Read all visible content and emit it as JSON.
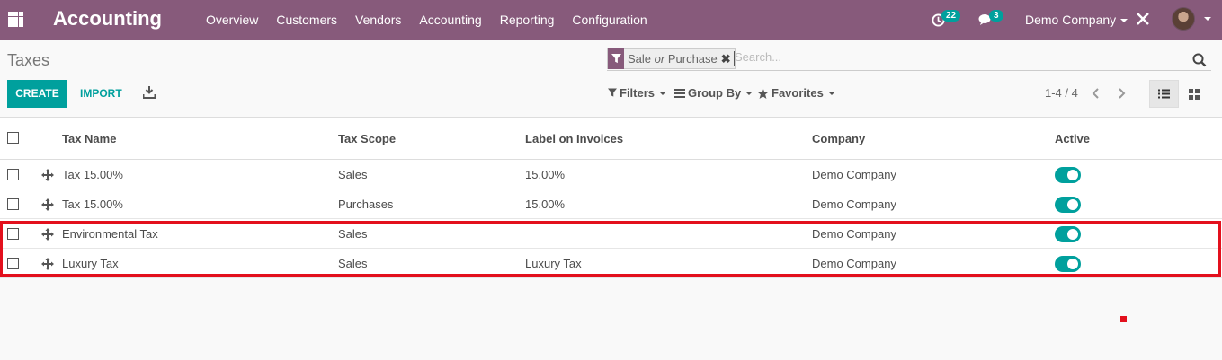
{
  "navbar": {
    "app_title": "Accounting",
    "menu": [
      "Overview",
      "Customers",
      "Vendors",
      "Accounting",
      "Reporting",
      "Configuration"
    ],
    "activity_count": "22",
    "message_count": "3",
    "company": "Demo Company"
  },
  "control_panel": {
    "breadcrumb": "Taxes",
    "facet_prefix": "Sale",
    "facet_or": "or",
    "facet_suffix": "Purchase",
    "search_placeholder": "Search...",
    "create_label": "CREATE",
    "import_label": "IMPORT",
    "filters_label": "Filters",
    "group_by_label": "Group By",
    "favorites_label": "Favorites",
    "pager": "1-4 / 4"
  },
  "table": {
    "columns": [
      "Tax Name",
      "Tax Scope",
      "Label on Invoices",
      "Company",
      "Active"
    ],
    "rows": [
      {
        "name": "Tax 15.00%",
        "scope": "Sales",
        "label": "15.00%",
        "company": "Demo Company",
        "active": true
      },
      {
        "name": "Tax 15.00%",
        "scope": "Purchases",
        "label": "15.00%",
        "company": "Demo Company",
        "active": true
      },
      {
        "name": "Environmental Tax",
        "scope": "Sales",
        "label": "",
        "company": "Demo Company",
        "active": true
      },
      {
        "name": "Luxury Tax",
        "scope": "Sales",
        "label": "Luxury Tax",
        "company": "Demo Company",
        "active": true
      }
    ]
  },
  "colors": {
    "navbar": "#875a7b",
    "accent": "#00a09d",
    "highlight": "#e3101d"
  }
}
